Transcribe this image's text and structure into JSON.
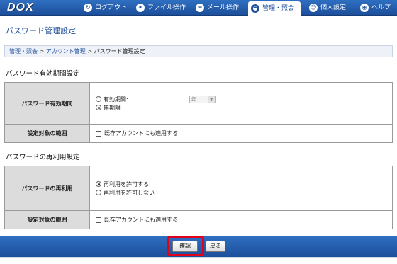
{
  "app": {
    "logo": "DOX"
  },
  "nav": {
    "items": [
      {
        "label": "ログアウト",
        "icon": "logout-icon",
        "glyph": "↻"
      },
      {
        "label": "ファイル操作",
        "icon": "file-ops-icon",
        "glyph": "✦"
      },
      {
        "label": "メール操作",
        "icon": "mail-icon",
        "glyph": "✉"
      },
      {
        "label": "管理・照会",
        "icon": "admin-icon",
        "glyph": "◒",
        "active": true
      },
      {
        "label": "個人設定",
        "icon": "person-icon",
        "glyph": "☺"
      },
      {
        "label": "ヘルプ",
        "icon": "help-icon",
        "glyph": "◉"
      }
    ]
  },
  "page": {
    "title": "パスワード管理設定"
  },
  "breadcrumb": {
    "items": [
      "管理・照会",
      "アカウント管理",
      "パスワード管理設定"
    ],
    "separator": ">"
  },
  "expiry": {
    "heading": "パスワード有効期間設定",
    "label": "パスワード有効期間",
    "option_period": "有効期間:",
    "period_value": "",
    "unit_select": "年",
    "option_unlimited": "無期限",
    "selected": "unlimited",
    "scope_label": "設定対象の範囲",
    "scope_checkbox": "既存アカウントにも適用する"
  },
  "reuse": {
    "heading": "パスワードの再利用設定",
    "label": "パスワードの再利用",
    "option_allow": "再利用を許可する",
    "option_deny": "再利用を許可しない",
    "selected": "allow",
    "scope_label": "設定対象の範囲",
    "scope_checkbox": "既存アカウントにも適用する"
  },
  "buttons": {
    "confirm": "確認",
    "back": "戻る"
  },
  "colors": {
    "brand": "#1d4f9b",
    "highlight": "#e2001a"
  }
}
